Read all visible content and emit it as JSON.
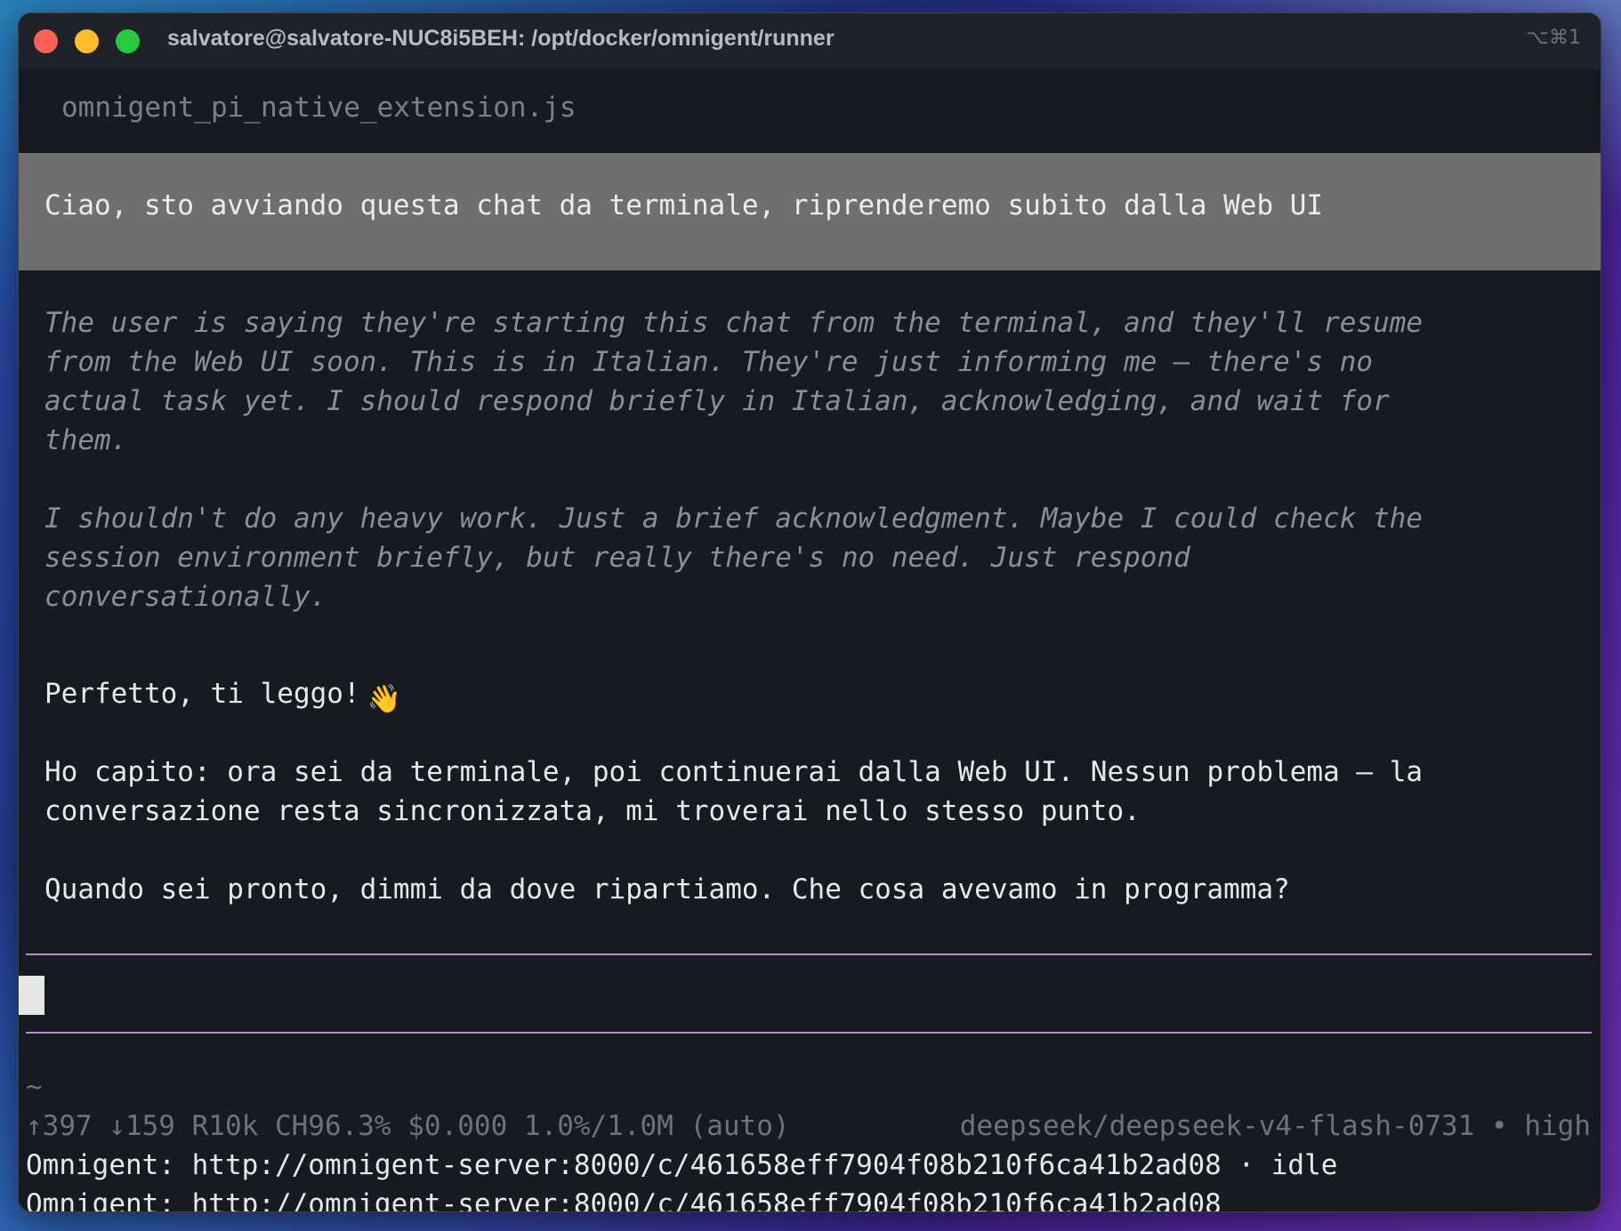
{
  "window": {
    "title": "salvatore@salvatore-NUC8i5BEH: /opt/docker/omnigent/runner",
    "shortcut": "⌥⌘1"
  },
  "terminal": {
    "filename": "omnigent_pi_native_extension.js",
    "user_message": "Ciao, sto avviando questa chat da terminale, riprenderemo subito dalla Web UI",
    "thinking": [
      "The user is saying they're starting this chat from the terminal, and they'll resume\nfrom the Web UI soon. This is in Italian. They're just informing me — there's no\nactual task yet. I should respond briefly in Italian, acknowledging, and wait for\nthem.",
      "I shouldn't do any heavy work. Just a brief acknowledgment. Maybe I could check the\nsession environment briefly, but really there's no need. Just respond\nconversationally."
    ],
    "reply": {
      "greeting": "Perfetto, ti leggo!",
      "greeting_emoji": "👋",
      "paragraph": "Ho capito: ora sei da terminale, poi continuerai dalla Web UI. Nessun problema — la\nconversazione resta sincronizzata, mi troverai nello stesso punto.",
      "question": "Quando sei pronto, dimmi da dove ripartiamo. Che cosa avevamo in programma?"
    },
    "tilde": "~",
    "status_left": "↑397 ↓159 R10k CH96.3% $0.000 1.0%/1.0M (auto)",
    "status_model": "deepseek/deepseek-v4-flash-0731 • high",
    "omnigent_status": "Omnigent: http://omnigent-server:8000/c/461658eff7904f08b210f6ca41b2ad08 · idle",
    "omnigent_url": "Omnigent: http://omnigent-server:8000/c/461658eff7904f08b210f6ca41b2ad08"
  },
  "colors": {
    "terminal_bg": "#171b21",
    "user_message_bg": "#6f6f6f",
    "editor_rule": "#b58fbf",
    "close": "#fe5f57",
    "minimize": "#febc2e",
    "maximize": "#28c840"
  }
}
